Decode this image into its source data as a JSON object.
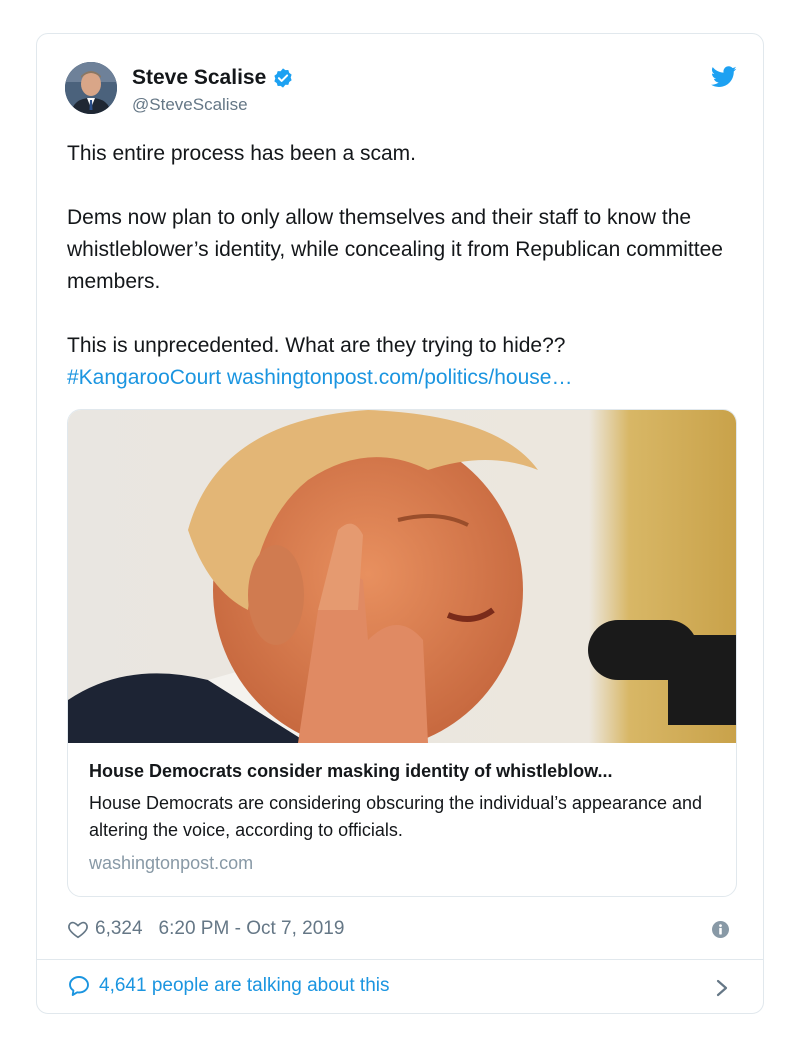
{
  "author": {
    "name": "Steve Scalise",
    "handle": "@SteveScalise",
    "verified": true
  },
  "tweet": {
    "line1": "This entire process has been a scam.",
    "line2": "Dems now plan to only allow themselves and their staff to know the whistleblower’s identity, while concealing it from Republican committee members.",
    "line3": "This is unprecedented. What are they trying to hide??",
    "hashtag": "#KangarooCourt",
    "link": "washingtonpost.com/politics/house…"
  },
  "card": {
    "title": "House Democrats consider masking identity of whistleblow...",
    "description": "House Democrats are considering obscuring the individual’s appearance and altering the voice, according to officials.",
    "domain": "washingtonpost.com"
  },
  "meta": {
    "likes": "6,324",
    "timestamp": "6:20 PM - Oct 7, 2019"
  },
  "conversation": {
    "label": "4,641 people are talking about this"
  },
  "icons": {
    "verified": "verified-badge-icon",
    "bird": "twitter-bird-icon",
    "like": "heart-icon",
    "info": "info-icon",
    "reply": "speech-bubble-icon",
    "chevron": "chevron-right-icon"
  },
  "colors": {
    "accent": "#1b95e0",
    "muted": "#657786",
    "border": "#e1e8ed"
  }
}
